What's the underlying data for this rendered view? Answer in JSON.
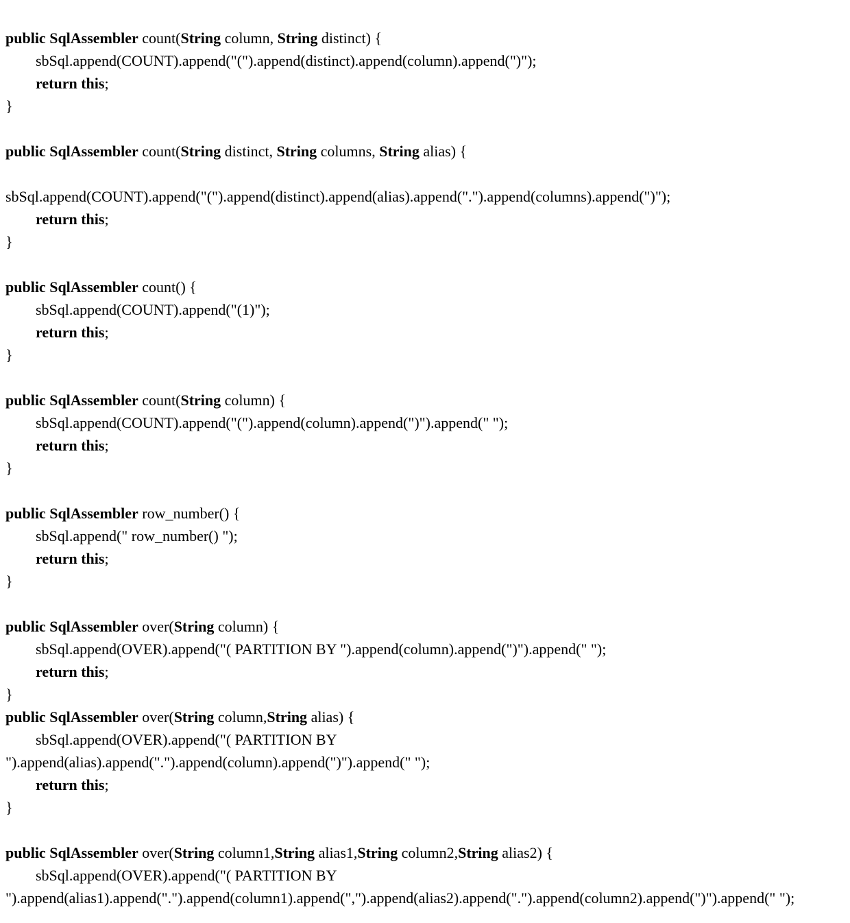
{
  "kw": {
    "public": "public",
    "retType": "SqlAssembler",
    "return_this": "return this",
    "String": "String"
  },
  "m1": {
    "name": "count",
    "p1": "column",
    "p2": "distinct",
    "body": "sbSql.append(COUNT).append(\"(\").append(distinct).append(column).append(\")\");"
  },
  "m2": {
    "name": "count",
    "p1": "distinct",
    "p2": "columns",
    "p3": "alias",
    "body": "sbSql.append(COUNT).append(\"(\").append(distinct).append(alias).append(\".\").append(columns).append(\")\");"
  },
  "m3": {
    "name": "count",
    "body": "sbSql.append(COUNT).append(\"(1)\");"
  },
  "m4": {
    "name": "count",
    "p1": "column",
    "body": "sbSql.append(COUNT).append(\"(\").append(column).append(\")\").append(\" \");"
  },
  "m5": {
    "name": "row_number",
    "body": "sbSql.append(\" row_number() \");"
  },
  "m6": {
    "name": "over",
    "p1": "column",
    "body": "sbSql.append(OVER).append(\"( PARTITION BY \").append(column).append(\")\").append(\" \");"
  },
  "m7": {
    "name": "over",
    "p1": "column",
    "p2": "alias",
    "body1": "sbSql.append(OVER).append(\"( PARTITION BY",
    "body2": "\").append(alias).append(\".\").append(column).append(\")\").append(\" \");"
  },
  "m8": {
    "name": "over",
    "p1": "column1",
    "p2": "alias1",
    "p3": "column2",
    "p4": "alias2",
    "body1": "sbSql.append(OVER).append(\"( PARTITION BY",
    "body2": "\").append(alias1).append(\".\").append(column1).append(\",\").append(alias2).append(\".\").append(column2).append(\")\").append(\" \");"
  }
}
